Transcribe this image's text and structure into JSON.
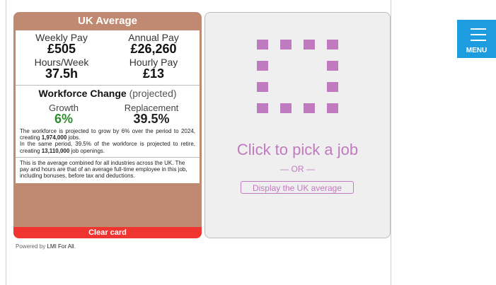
{
  "card": {
    "title": "UK Average",
    "weekly_pay_label": "Weekly Pay",
    "weekly_pay_value": "£505",
    "annual_pay_label": "Annual Pay",
    "annual_pay_value": "£26,260",
    "hours_label": "Hours/Week",
    "hours_value": "37.5h",
    "hourly_label": "Hourly Pay",
    "hourly_value": "£13",
    "workforce_title": "Workforce Change",
    "workforce_suffix": "(projected)",
    "growth_label": "Growth",
    "growth_value": "6%",
    "replacement_label": "Replacement",
    "replacement_value": "39.5%",
    "wf_text_1": "The workforce is projected to grow by 6% over the period to 2024, creating ",
    "wf_jobs": "1,974,000",
    "wf_text_2": " jobs.",
    "wf_text_3": "In the same period, 39.5% of the workforce is projected to retire, creating ",
    "wf_openings": "13,110,000",
    "wf_text_4": " job openings.",
    "note": "This is the average combined for all industries across the UK. The pay and hours are that of an average full-time employee in this job, including bonuses, before tax and deductions.",
    "clear_label": "Clear card"
  },
  "footer": {
    "powered_prefix": "Powered by ",
    "powered_link": "LMI For All",
    "powered_suffix": "."
  },
  "picker": {
    "title": "Click to pick a job",
    "or_text": "— OR —",
    "uk_average_button": "Display the UK average"
  },
  "menu": {
    "label": "MENU"
  },
  "colors": {
    "card_bg": "#bf8a71",
    "clear_button": "#f0342f",
    "accent": "#c07abf",
    "growth": "#2e8b2e",
    "menu_bg": "#1e9ce0"
  }
}
